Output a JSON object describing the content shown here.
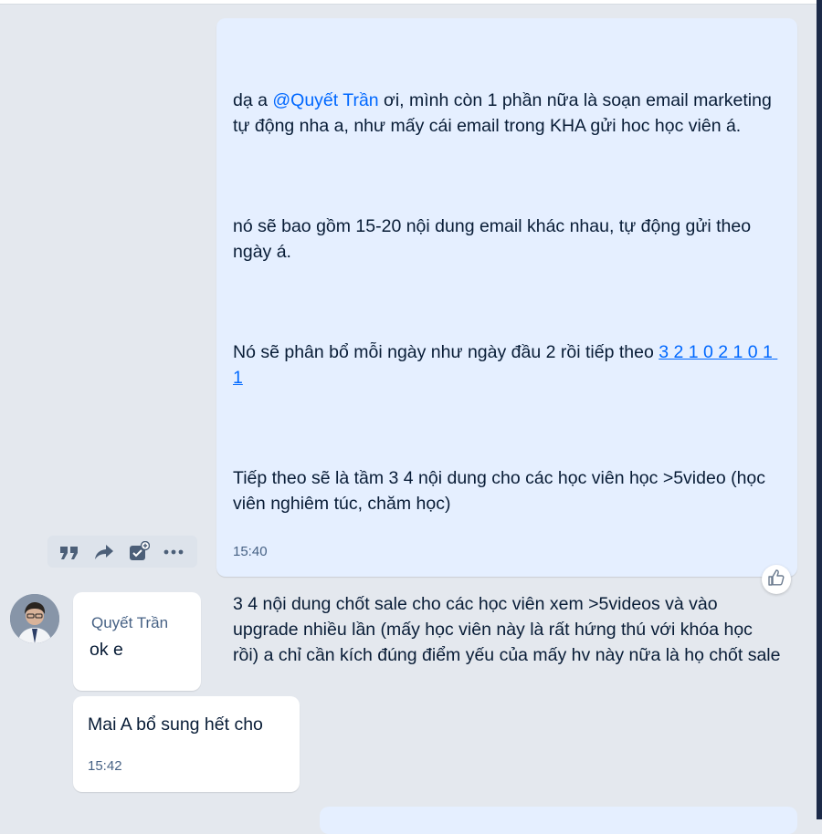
{
  "outgoing_message": {
    "greeting_prefix": "dạ a ",
    "mention": "@Quyết Trần",
    "p1_rest": " ơi, mình còn 1 phần nữa là soạn email marketing tự động nha a, như mấy cái email trong KHA gửi hoc học viên á.",
    "p2": "nó sẽ bao gồm 15-20 nội dung email khác nhau, tự động gửi theo ngày á.",
    "p3_text": "Nó sẽ phân bổ mỗi ngày như ngày đầu 2 rồi tiếp theo ",
    "p3_link": "3 2 1 0 2 1 0 1 1",
    "p4": "Tiếp theo sẽ là tầm 3 4 nội dung cho các học viên học >5video (học viên nghiêm túc, chăm học)",
    "p5": "3 4 nội dung chốt sale cho các học viên xem >5videos và vào upgrade nhiều lần (mấy học viên này là rất hứng thú với khóa học rồi) a chỉ cần kích đúng điểm yếu của mấy hv này nữa là họ chốt sale",
    "time": "15:40"
  },
  "incoming_messages": {
    "sender_name": "Quyết Trần",
    "msg1": "ok e",
    "msg2": "Mai A bổ sung hết cho",
    "time": "15:42"
  },
  "icons": [
    "quote-icon",
    "forward-icon",
    "add-task-icon",
    "more-icon",
    "like-icon",
    "avatar"
  ],
  "colors": {
    "bubble_me": "#e5efff",
    "mention": "#0068ff",
    "text": "#081c36",
    "time": "#476285"
  }
}
